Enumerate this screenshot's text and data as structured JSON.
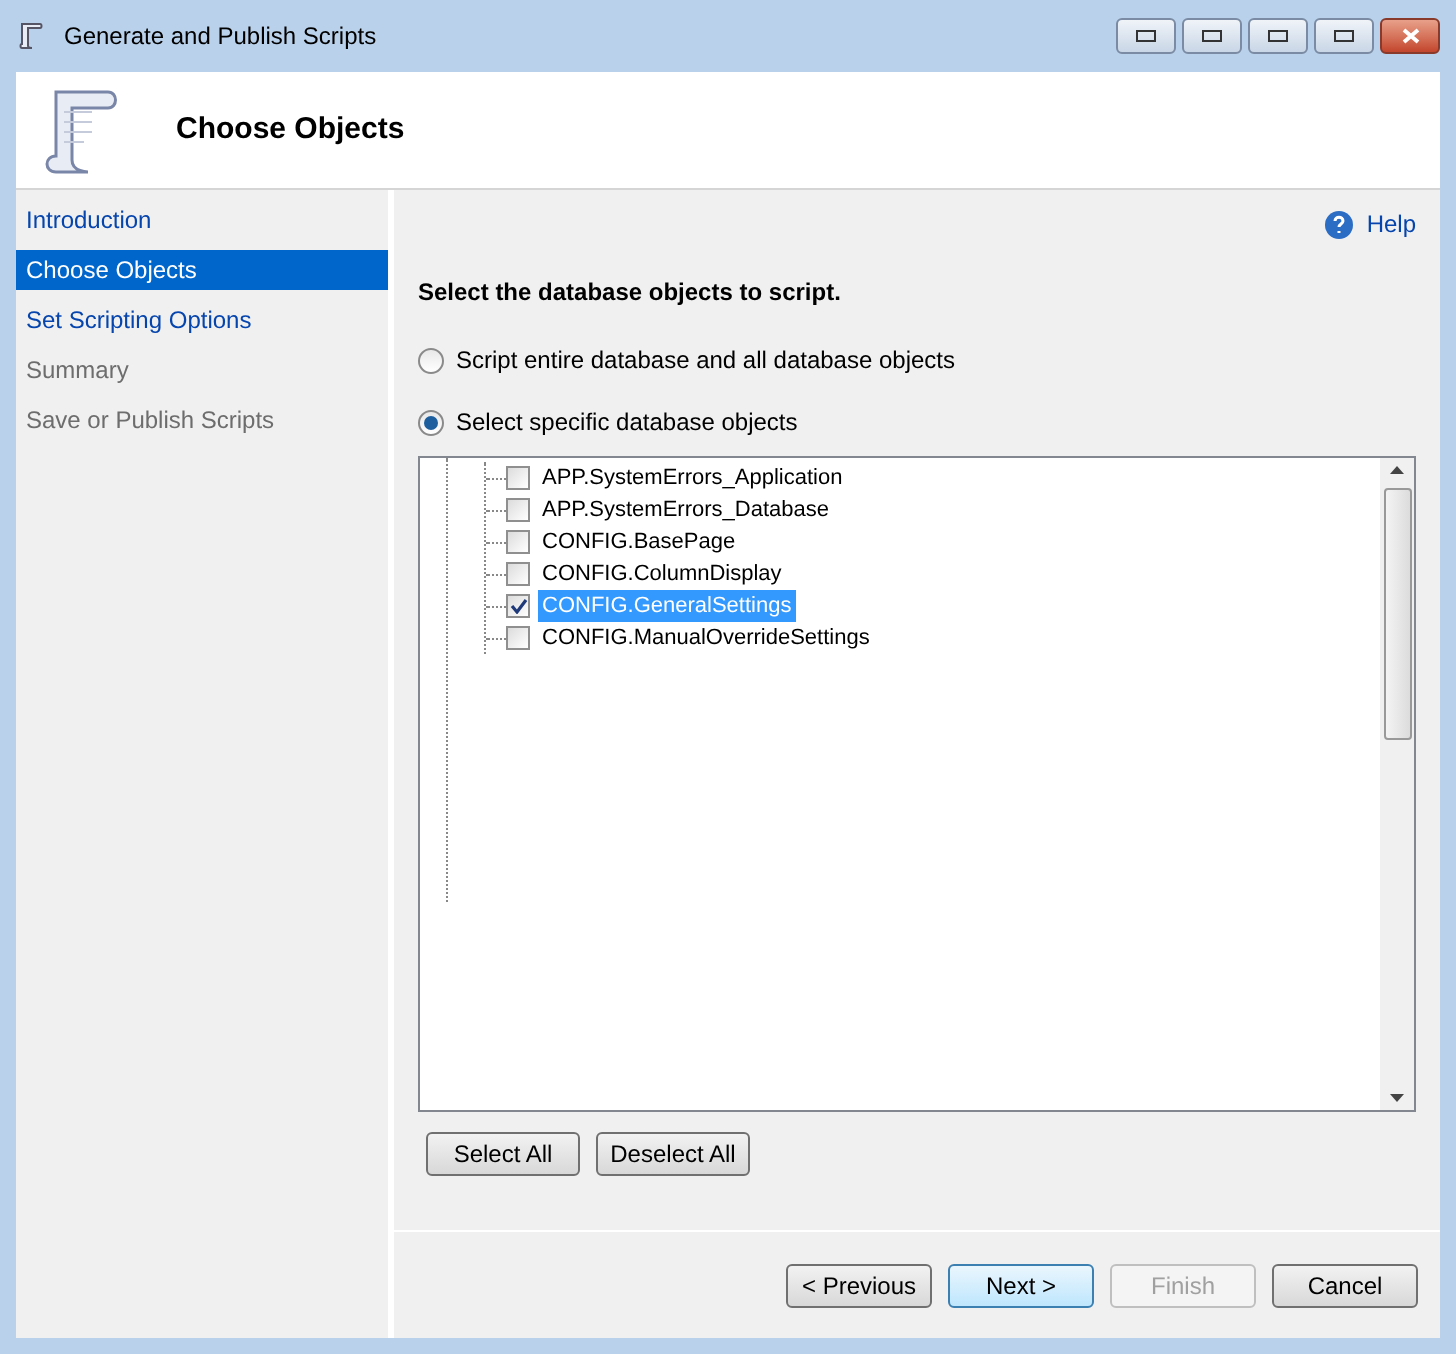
{
  "window": {
    "title": "Generate and Publish Scripts"
  },
  "header": {
    "title": "Choose Objects"
  },
  "sidebar": {
    "items": [
      {
        "label": "Introduction",
        "selected": false,
        "disabled": false
      },
      {
        "label": "Choose Objects",
        "selected": true,
        "disabled": false
      },
      {
        "label": "Set Scripting Options",
        "selected": false,
        "disabled": false
      },
      {
        "label": "Summary",
        "selected": false,
        "disabled": true
      },
      {
        "label": "Save or Publish Scripts",
        "selected": false,
        "disabled": true
      }
    ]
  },
  "help": {
    "label": "Help"
  },
  "instruction": "Select the database objects to script.",
  "options": [
    {
      "label": "Script entire database and all database objects",
      "selected": false
    },
    {
      "label": "Select specific database objects",
      "selected": true
    }
  ],
  "tree": {
    "items": [
      {
        "label": "APP.SystemErrors_Application",
        "checked": false,
        "selected": false
      },
      {
        "label": "APP.SystemErrors_Database",
        "checked": false,
        "selected": false
      },
      {
        "label": "CONFIG.BasePage",
        "checked": false,
        "selected": false
      },
      {
        "label": "CONFIG.ColumnDisplay",
        "checked": false,
        "selected": false
      },
      {
        "label": "CONFIG.GeneralSettings",
        "checked": true,
        "selected": true
      },
      {
        "label": "CONFIG.ManualOverrideSettings",
        "checked": false,
        "selected": false
      }
    ]
  },
  "tree_buttons": [
    "Select All",
    "Deselect All"
  ],
  "footer_buttons": [
    {
      "label": "< Previous",
      "disabled": false,
      "default": false
    },
    {
      "label": "Next >",
      "disabled": false,
      "default": true
    },
    {
      "label": "Finish",
      "disabled": true,
      "default": false
    },
    {
      "label": "Cancel",
      "disabled": false,
      "default": false
    }
  ]
}
